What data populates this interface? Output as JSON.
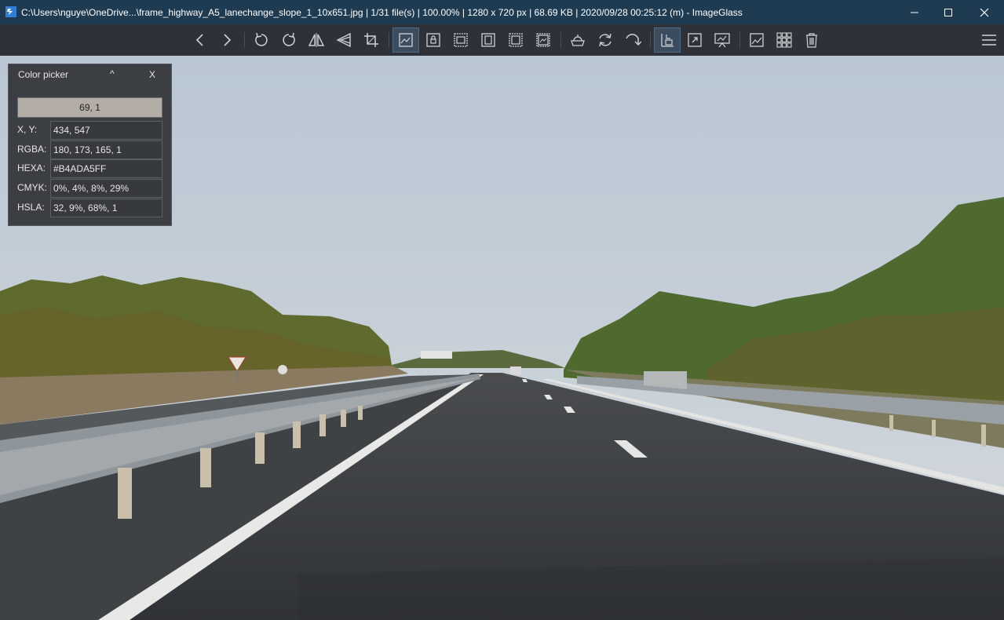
{
  "titlebar": {
    "title": "C:\\Users\\nguye\\OneDrive...\\frame_highway_A5_lanechange_slope_1_10x651.jpg  |  1/31 file(s)  |  100.00%  |  1280 x 720 px  |  68.69 KB  |  2020/09/28 00:25:12 (m)  - ImageGlass",
    "app_icon": "imageglass-app-icon",
    "colors": {
      "background": "#1f3b52",
      "text": "#ffffff"
    }
  },
  "toolbar": {
    "buttons": [
      {
        "icon": "chevron-left-icon"
      },
      {
        "icon": "chevron-right-icon"
      },
      {
        "icon": "rotate-left-icon"
      },
      {
        "icon": "rotate-right-icon"
      },
      {
        "icon": "flip-horizontal-icon"
      },
      {
        "icon": "flip-vertical-icon"
      },
      {
        "icon": "crop-icon"
      },
      {
        "icon": "auto-zoom-icon",
        "active": true
      },
      {
        "icon": "lock-zoom-icon"
      },
      {
        "icon": "scale-to-width-icon"
      },
      {
        "icon": "scale-to-height-icon"
      },
      {
        "icon": "scale-to-fit-icon"
      },
      {
        "icon": "scale-to-fill-icon"
      },
      {
        "icon": "checkerboard-icon"
      },
      {
        "icon": "refresh-icon"
      },
      {
        "icon": "go-to-image-icon"
      },
      {
        "icon": "thumbnail-bar-icon",
        "active": true
      },
      {
        "icon": "fullscreen-icon"
      },
      {
        "icon": "slideshow-icon"
      },
      {
        "icon": "open-with-icon"
      },
      {
        "icon": "gallery-grid-icon"
      },
      {
        "icon": "delete-icon"
      },
      {
        "icon": "hamburger-menu-icon"
      }
    ]
  },
  "color_picker": {
    "title": "Color picker",
    "collapse_label": "^",
    "close_label": "X",
    "swatch_value": "69, 1",
    "swatch_color": "#b4ada5",
    "rows": [
      {
        "label": "X, Y:",
        "value": "434, 547"
      },
      {
        "label": "RGBA:",
        "value": "180, 173, 165, 1"
      },
      {
        "label": "HEXA:",
        "value": "#B4ADA5FF"
      },
      {
        "label": "CMYK:",
        "value": "0%, 4%, 8%, 29%"
      },
      {
        "label": "HSLA:",
        "value": "32, 9%, 68%, 1"
      }
    ]
  },
  "image": {
    "description_icon": "highway-photo",
    "colors": {
      "sky": "#c7d0d8",
      "road": "#3b3e42",
      "trees": "#5a6a32"
    }
  }
}
